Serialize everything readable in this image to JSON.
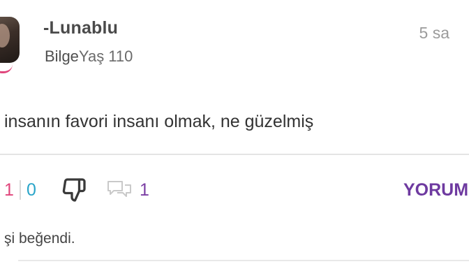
{
  "post": {
    "author": {
      "username": "-Lunablu",
      "rank_title": "Bilge",
      "rank_age": "Yaş 110",
      "avatar": "avatar"
    },
    "timestamp": "5 sa",
    "text": "insanın favori insanı olmak, ne güzelmiş"
  },
  "actions": {
    "upvotes": "1",
    "downvotes": "0",
    "dislike_icon": "thumbs-down-icon",
    "comment_icon": "comment-bubbles-icon",
    "comment_count": "1",
    "reply_label": "YORUM"
  },
  "likes_text": "şi beğendi.",
  "colors": {
    "upvote": "#e0457b",
    "downvote": "#2aa5c9",
    "accent_purple": "#6e3aa0",
    "divider": "#e4e4e4"
  }
}
